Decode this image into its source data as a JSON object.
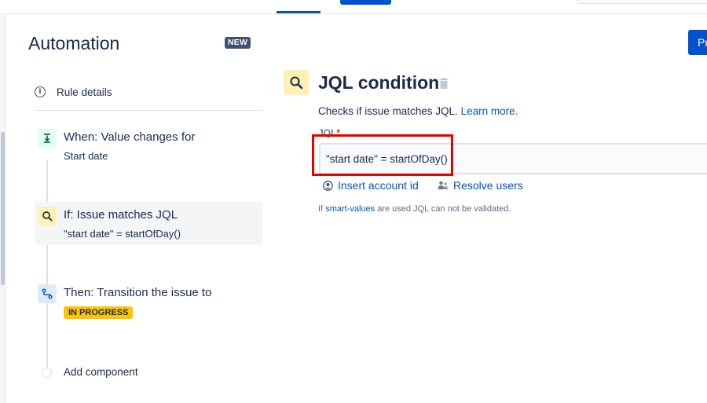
{
  "app": {
    "title": "Automation",
    "new_badge": "NEW",
    "primary_button_label": "Pr"
  },
  "sidebar": {
    "rule_details_label": "Rule details",
    "steps": [
      {
        "kind": "trigger",
        "icon": "value-change-icon",
        "title": "When: Value changes for",
        "subtitle": "Start date"
      },
      {
        "kind": "condition",
        "icon": "search-icon",
        "title": "If: Issue matches JQL",
        "subtitle": "\"start date\" = startOfDay()"
      },
      {
        "kind": "action",
        "icon": "transition-icon",
        "title": "Then: Transition the issue to",
        "status": "IN PROGRESS"
      }
    ],
    "add_component_label": "Add component"
  },
  "main": {
    "condition_title": "JQL condition",
    "description": "Checks if issue matches JQL.",
    "learn_more": "Learn more.",
    "jql_label": "JQL",
    "jql_required_mark": "*",
    "jql_value": "\"start date\" = startOfDay()",
    "insert_account_label": "Insert account id",
    "resolve_users_label": "Resolve users",
    "note_prefix": "If",
    "note_link": "smart-values",
    "note_suffix": "are used JQL can not be validated."
  },
  "colors": {
    "brand_blue": "#0052cc",
    "highlight_red": "#e60000",
    "status_yellow": "#ffc400",
    "condition_yellow": "#fff0b3",
    "trigger_green": "#e3fcef",
    "action_blue": "#deebff"
  }
}
